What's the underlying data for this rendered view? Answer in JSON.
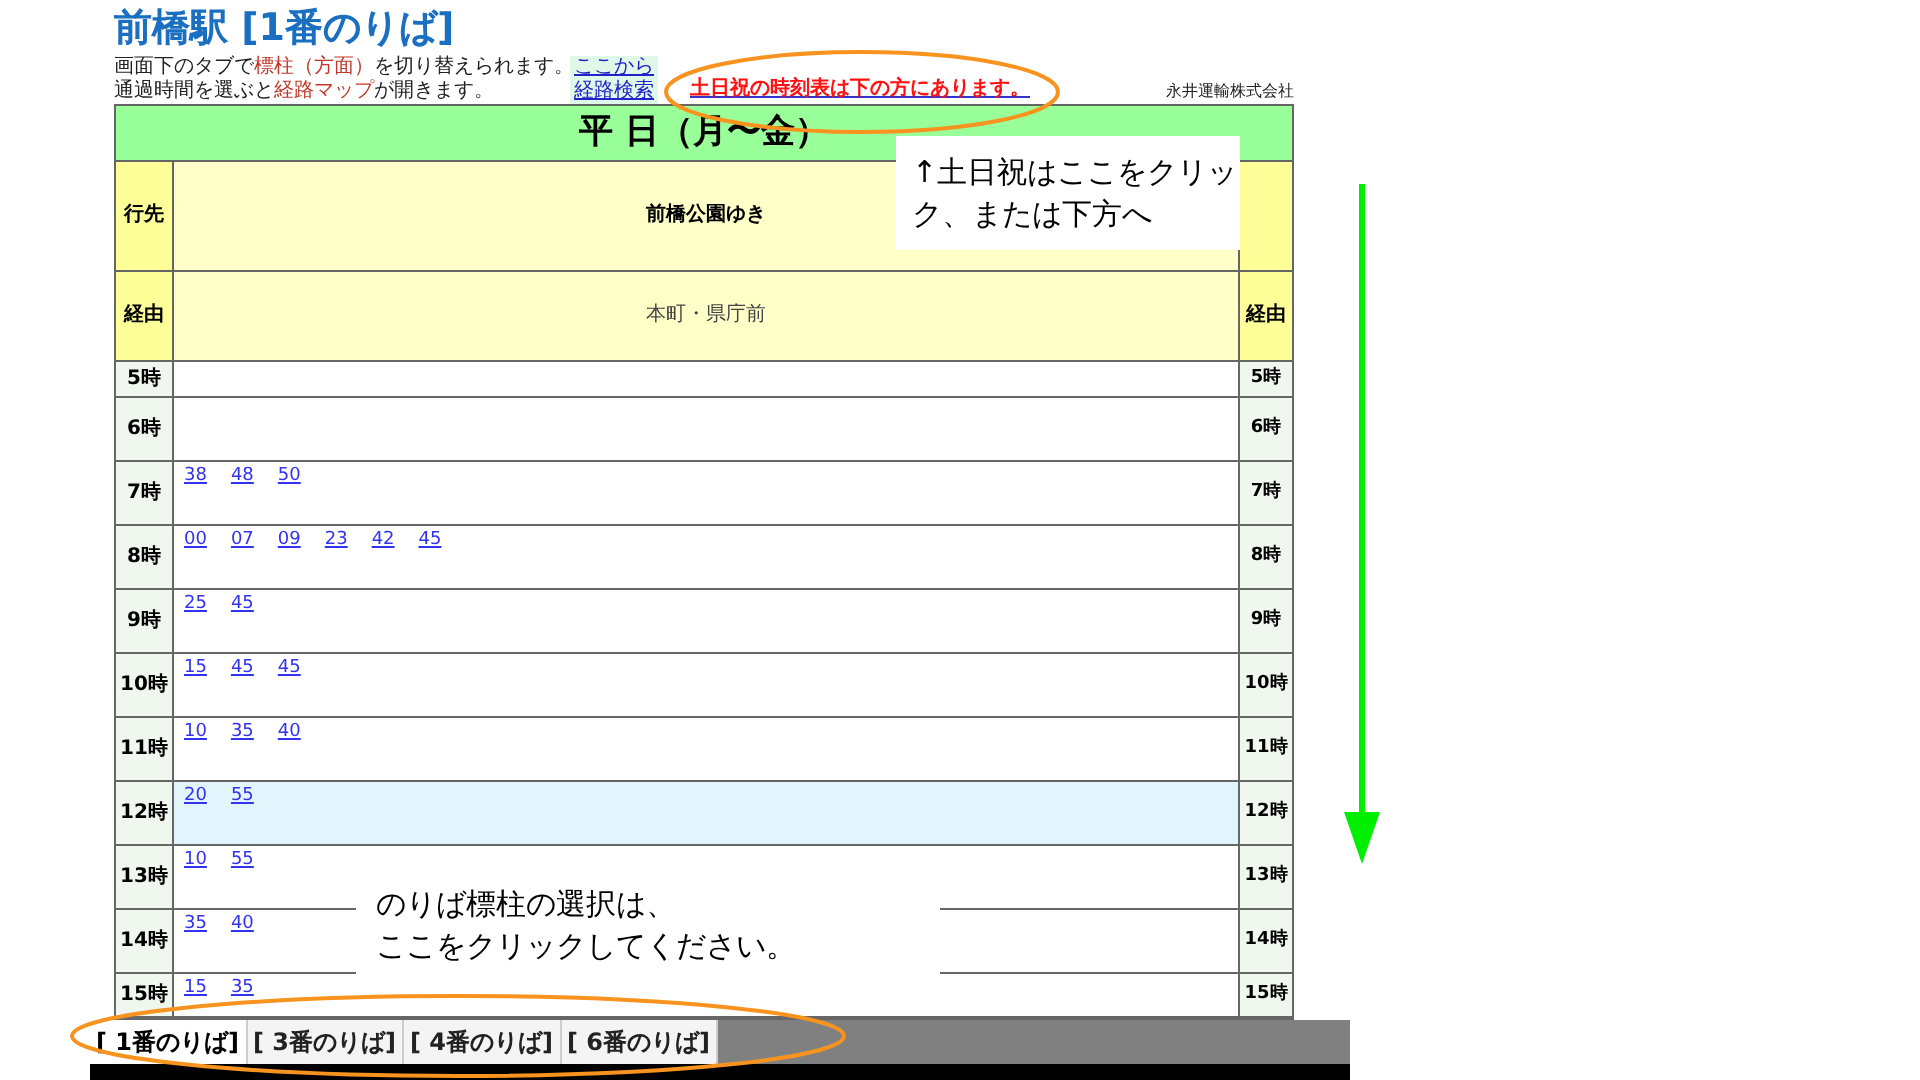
{
  "page_title": "前橋駅 [1番のりば]",
  "notes": [
    [
      {
        "text": "画面下のタブで",
        "highlight": false
      },
      {
        "text": "標柱（方面）",
        "highlight": true
      },
      {
        "text": "を切り替えられます。",
        "highlight": false
      }
    ],
    [
      {
        "text": "通過時間を選ぶと",
        "highlight": false
      },
      {
        "text": "経路マップ",
        "highlight": true
      },
      {
        "text": "が開きます。",
        "highlight": false
      }
    ]
  ],
  "route_search_link": [
    "ここから",
    "経路検索"
  ],
  "weekend_link": "土日祝の時刻表は下の方にあります。",
  "company": "永井運輸株式会社",
  "timetable": {
    "title": "平 日（月〜金）",
    "destination_label": "行先",
    "destination": "前橋公園ゆき",
    "via_label": "経由",
    "via": "本町・県庁前",
    "via_label_right": "経由",
    "hours": [
      {
        "left": "5時",
        "right": "5時",
        "highlighted": false,
        "kind": "short"
      },
      {
        "left": "6時",
        "right": "6時",
        "highlighted": false,
        "kind": "full"
      },
      {
        "left": "7時",
        "right": "7時",
        "minutes": [
          "38",
          "48",
          "50"
        ],
        "highlighted": false,
        "kind": "full"
      },
      {
        "left": "8時",
        "right": "8時",
        "minutes": [
          "00",
          "07",
          "09",
          "23",
          "42",
          "45"
        ],
        "highlighted": false,
        "kind": "full"
      },
      {
        "left": "9時",
        "right": "9時",
        "minutes": [
          "25",
          "45"
        ],
        "highlighted": false,
        "kind": "full"
      },
      {
        "left": "10時",
        "right": "10時",
        "minutes": [
          "15",
          "45",
          "45"
        ],
        "highlighted": false,
        "kind": "full"
      },
      {
        "left": "11時",
        "right": "11時",
        "minutes": [
          "10",
          "35",
          "40"
        ],
        "highlighted": false,
        "kind": "full"
      },
      {
        "left": "12時",
        "right": "12時",
        "minutes": [
          "20",
          "55"
        ],
        "highlighted": true,
        "kind": "full"
      },
      {
        "left": "13時",
        "right": "13時",
        "minutes": [
          "10",
          "55"
        ],
        "highlighted": false,
        "kind": "full"
      },
      {
        "left": "14時",
        "right": "14時",
        "minutes": [
          "35",
          "40"
        ],
        "highlighted": false,
        "kind": "full"
      },
      {
        "left": "15時",
        "right": "15時",
        "minutes": [
          "15",
          "35"
        ],
        "highlighted": false,
        "kind": "cut"
      }
    ]
  },
  "platform_tabs": [
    {
      "label": "[ 1番のりば]",
      "selected": true
    },
    {
      "label": "[ 3番のりば]",
      "selected": false
    },
    {
      "label": "[ 4番のりば]",
      "selected": false
    },
    {
      "label": "[ 6番のりば]",
      "selected": false
    }
  ],
  "callouts": [
    {
      "lines": [
        "↑土日祝はここをクリッ",
        "ク、または下方へ"
      ]
    },
    {
      "lines": [
        "のりば標柱の選択は、",
        "ここをクリックしてください。"
      ]
    }
  ]
}
